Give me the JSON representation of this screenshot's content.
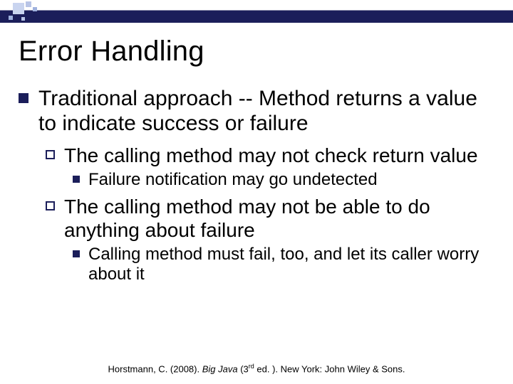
{
  "title": "Error Handling",
  "bullets": {
    "b1": "Traditional approach -- Method returns a value to indicate success or failure",
    "b1a": "The calling method may not check return value",
    "b1a_i": "Failure notification may go undetected",
    "b1b": "The calling method may not be able to do anything about failure",
    "b1b_i": "Calling method must fail, too, and let its caller worry about it"
  },
  "citation": {
    "author": "Horstmann, C. (2008). ",
    "title_italic": "Big Java ",
    "edition_open": "(3",
    "edition_sup": "rd",
    "edition_close": " ed. ). New York: John Wiley & Sons."
  }
}
